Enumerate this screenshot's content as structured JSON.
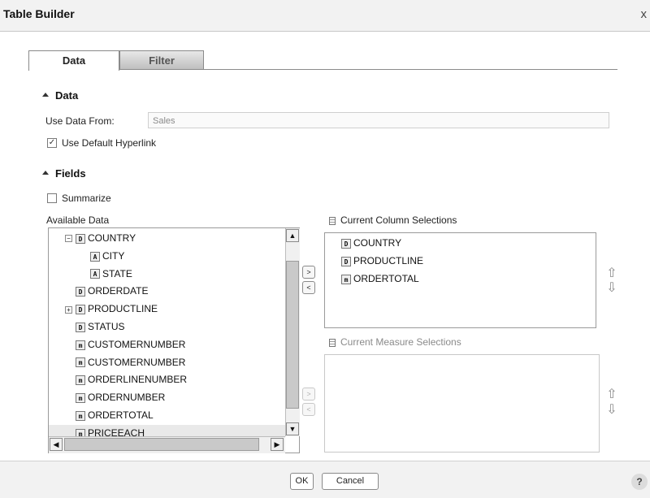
{
  "window": {
    "title": "Table Builder",
    "close_glyph": "x"
  },
  "tabs": [
    {
      "label": "Data",
      "active": true
    },
    {
      "label": "Filter",
      "active": false
    }
  ],
  "data_section": {
    "header": "Data",
    "use_data_from_label": "Use Data From:",
    "use_data_from_value": "Sales",
    "default_hyperlink_label": "Use Default Hyperlink",
    "default_hyperlink_checked": true
  },
  "fields_section": {
    "header": "Fields",
    "summarize_label": "Summarize",
    "summarize_checked": false,
    "available_label": "Available Data",
    "available_items": [
      {
        "label": "COUNTRY",
        "type": "D",
        "expander": "−",
        "level": 0
      },
      {
        "label": "CITY",
        "type": "A",
        "expander": "",
        "level": 1
      },
      {
        "label": "STATE",
        "type": "A",
        "expander": "",
        "level": 1
      },
      {
        "label": "ORDERDATE",
        "type": "D",
        "expander": "",
        "level": 0
      },
      {
        "label": "PRODUCTLINE",
        "type": "D",
        "expander": "+",
        "level": 0
      },
      {
        "label": "STATUS",
        "type": "D",
        "expander": "",
        "level": 0
      },
      {
        "label": "CUSTOMERNUMBER",
        "type": "m",
        "expander": "",
        "level": 0
      },
      {
        "label": "CUSTOMERNUMBER",
        "type": "m",
        "expander": "",
        "level": 0
      },
      {
        "label": "ORDERLINENUMBER",
        "type": "m",
        "expander": "",
        "level": 0
      },
      {
        "label": "ORDERNUMBER",
        "type": "m",
        "expander": "",
        "level": 0
      },
      {
        "label": "ORDERTOTAL",
        "type": "m",
        "expander": "",
        "level": 0
      },
      {
        "label": "PRICEEACH",
        "type": "m",
        "expander": "",
        "level": 0,
        "selected": true
      }
    ],
    "column_selections_label": "Current Column Selections",
    "column_selections": [
      {
        "label": "COUNTRY",
        "type": "D"
      },
      {
        "label": "PRODUCTLINE",
        "type": "D"
      },
      {
        "label": "ORDERTOTAL",
        "type": "m"
      }
    ],
    "measure_selections_label": "Current Measure Selections",
    "move_right_glyph": ">",
    "move_left_glyph": "<",
    "up_glyph": "⇧",
    "down_glyph": "⇩"
  },
  "footer": {
    "ok_label": "OK",
    "cancel_label": "Cancel",
    "help_glyph": "?"
  }
}
